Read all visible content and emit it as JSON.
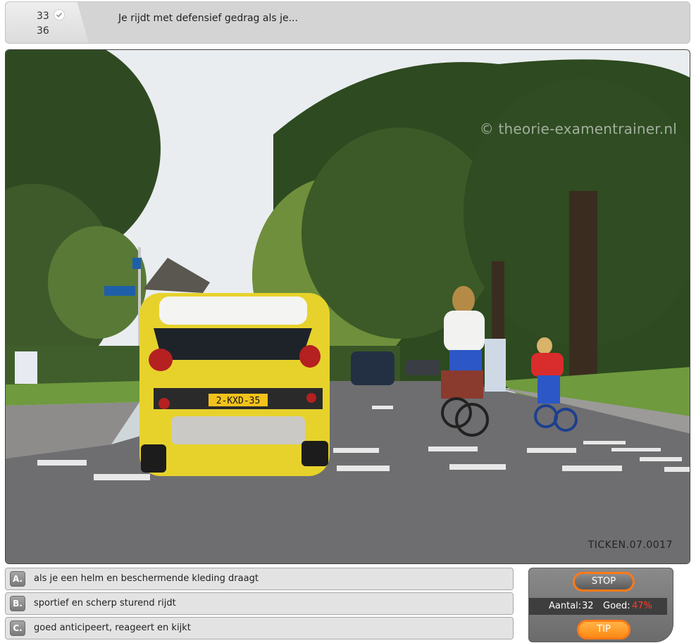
{
  "header": {
    "current": "33",
    "total": "36",
    "question": "Je rijdt met defensief gedrag als je..."
  },
  "scene": {
    "watermark": "© theorie-examentrainer.nl",
    "code": "TICKEN.07.0017",
    "plate": "2-KXD-35"
  },
  "answers": [
    {
      "letter": "A.",
      "text": "als je een helm en beschermende kleding draagt"
    },
    {
      "letter": "B.",
      "text": "sportief en scherp sturend rijdt"
    },
    {
      "letter": "C.",
      "text": "goed anticipeert, reageert en kijkt"
    }
  ],
  "panel": {
    "stop_label": "STOP",
    "tip_label": "TIP",
    "count_label": "Aantal:",
    "count_value": "32",
    "correct_label": "Goed:",
    "correct_value": "47%"
  },
  "colors": {
    "accent": "#ff7a18",
    "correct_value": "#ff3a2a",
    "car": "#e7d22c"
  }
}
